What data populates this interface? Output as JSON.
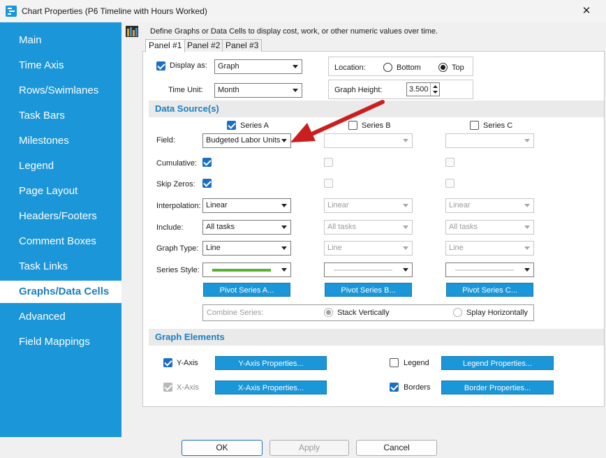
{
  "window": {
    "title": "Chart Properties (P6 Timeline with Hours Worked)",
    "close_glyph": "✕"
  },
  "sidebar": {
    "items": [
      {
        "label": "Main"
      },
      {
        "label": "Time Axis"
      },
      {
        "label": "Rows/Swimlanes"
      },
      {
        "label": "Task Bars"
      },
      {
        "label": "Milestones"
      },
      {
        "label": "Legend"
      },
      {
        "label": "Page Layout"
      },
      {
        "label": "Headers/Footers"
      },
      {
        "label": "Comment Boxes"
      },
      {
        "label": "Task Links"
      },
      {
        "label": "Graphs/Data Cells",
        "active": true
      },
      {
        "label": "Advanced"
      },
      {
        "label": "Field Mappings"
      }
    ]
  },
  "main": {
    "description": "Define Graphs or Data Cells to display cost, work, or other numeric values over time.",
    "tabs": [
      "Panel #1",
      "Panel #2",
      "Panel #3"
    ],
    "display_as": {
      "label": "Display as:",
      "checked": true,
      "value": "Graph"
    },
    "time_unit": {
      "label": "Time Unit:",
      "value": "Month"
    },
    "location": {
      "label": "Location:",
      "options": [
        "Bottom",
        "Top"
      ],
      "selected": "Top"
    },
    "graph_height": {
      "label": "Graph Height:",
      "value": "3.500"
    }
  },
  "data_source": {
    "title": "Data Source(s)",
    "series_headers": [
      "Series A",
      "Series B",
      "Series C"
    ],
    "row_labels": {
      "field": "Field:",
      "cumulative": "Cumulative:",
      "skip_zeros": "Skip Zeros:",
      "interpolation": "Interpolation:",
      "include": "Include:",
      "graph_type": "Graph Type:",
      "series_style": "Series Style:"
    },
    "series": [
      {
        "enabled": true,
        "field": "Budgeted Labor Units",
        "cumulative": true,
        "skip_zeros": true,
        "interpolation": "Linear",
        "include": "All tasks",
        "graph_type": "Line",
        "pivot_label": "Pivot Series A...",
        "style_color": "#5ab030"
      },
      {
        "enabled": false,
        "field": "",
        "cumulative": false,
        "skip_zeros": false,
        "interpolation": "Linear",
        "include": "All tasks",
        "graph_type": "Line",
        "pivot_label": "Pivot Series B...",
        "style_color": "#d8d8d8"
      },
      {
        "enabled": false,
        "field": "",
        "cumulative": false,
        "skip_zeros": false,
        "interpolation": "Linear",
        "include": "All tasks",
        "graph_type": "Line",
        "pivot_label": "Pivot Series C...",
        "style_color": "#d8d8d8"
      }
    ],
    "combine": {
      "label": "Combine Series:",
      "options": [
        "Stack Vertically",
        "Splay Horizontally"
      ],
      "selected": "Stack Vertically"
    }
  },
  "graph_elements": {
    "title": "Graph Elements",
    "y_axis": {
      "label": "Y-Axis",
      "checked": true,
      "button": "Y-Axis Properties..."
    },
    "x_axis": {
      "label": "X-Axis",
      "checked": true,
      "disabled": true,
      "button": "X-Axis Properties..."
    },
    "legend": {
      "label": "Legend",
      "checked": false,
      "button": "Legend Properties..."
    },
    "borders": {
      "label": "Borders",
      "checked": true,
      "button": "Border Properties..."
    }
  },
  "footer": {
    "ok": "OK",
    "apply": "Apply",
    "cancel": "Cancel"
  },
  "colors": {
    "sidebar": "#1b96d8",
    "accent": "#1b7fc0",
    "arrow": "#c91f1f",
    "checkbox": "#1a6fc4"
  },
  "icons": {
    "app": "chart-properties-icon",
    "header": "bar-chart-icon",
    "annotation": "red-arrow-pointer"
  }
}
